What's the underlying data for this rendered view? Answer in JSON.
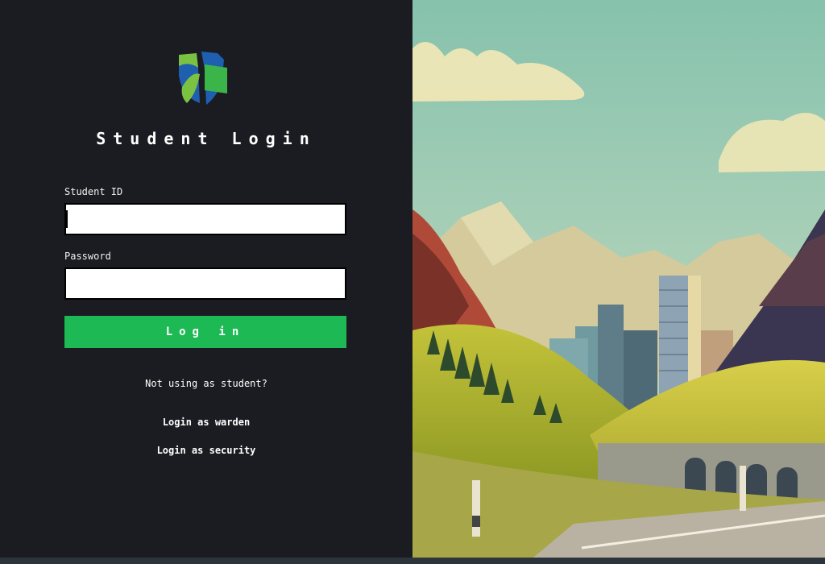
{
  "login": {
    "title": "Student Login",
    "student_id_label": "Student ID",
    "student_id_value": "",
    "password_label": "Password",
    "password_value": "",
    "login_button": "Log in",
    "not_student_text": "Not using as student?",
    "warden_link": "Login as warden",
    "security_link": "Login as security"
  },
  "colors": {
    "panel_background": "#1b1c21",
    "button_green": "#1db954",
    "logo_blue": "#1f5fb0",
    "logo_green": "#7cc242"
  },
  "icons": {
    "logo": "shield-leaf-logo-icon"
  }
}
